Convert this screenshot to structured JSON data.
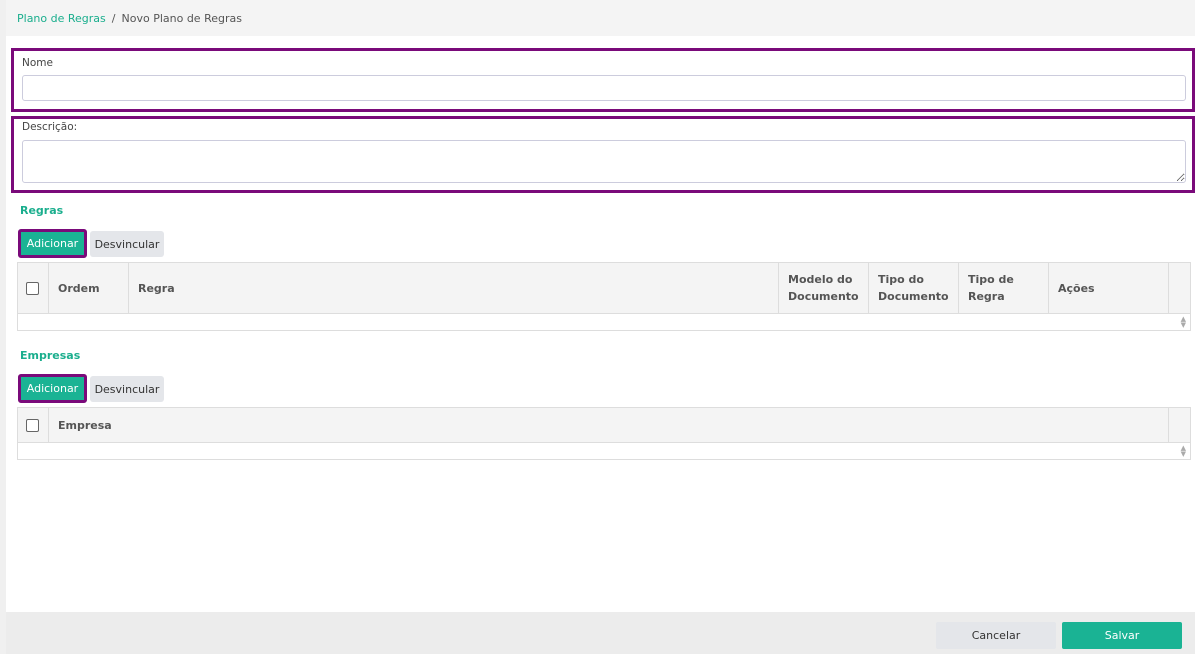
{
  "breadcrumb": {
    "parent": "Plano de Regras",
    "separator": "/",
    "current": "Novo Plano de Regras"
  },
  "form": {
    "nome_label": "Nome",
    "nome_value": "",
    "descricao_label": "Descrição:",
    "descricao_value": ""
  },
  "regras": {
    "title": "Regras",
    "add": "Adicionar",
    "unlink": "Desvincular",
    "columns": [
      "Ordem",
      "Regra",
      "Modelo do Documento",
      "Tipo do Documento",
      "Tipo de Regra",
      "Ações"
    ]
  },
  "empresas": {
    "title": "Empresas",
    "add": "Adicionar",
    "unlink": "Desvincular",
    "columns": [
      "Empresa"
    ]
  },
  "footer": {
    "cancel": "Cancelar",
    "save": "Salvar"
  }
}
